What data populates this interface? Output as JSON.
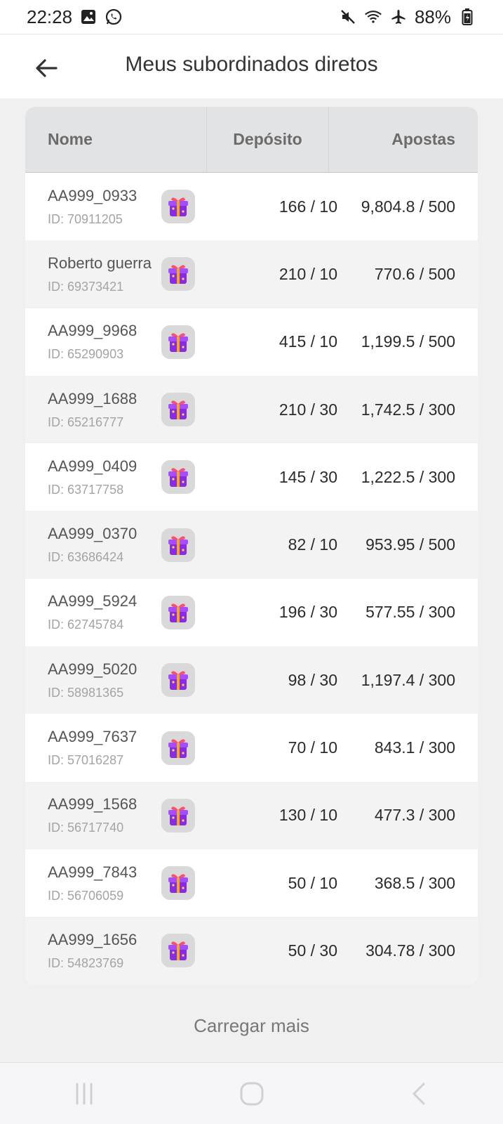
{
  "status_bar": {
    "time": "22:28",
    "battery": "88%",
    "icons": [
      "gallery-icon",
      "whatsapp-icon",
      "mute-icon",
      "wifi-icon",
      "airplane-icon",
      "battery-icon"
    ]
  },
  "header": {
    "title": "Meus subordinados diretos",
    "back_icon": "arrow-left-icon"
  },
  "table": {
    "columns": [
      "Nome",
      "Depósito",
      "Apostas"
    ],
    "rows": [
      {
        "name": "AA999_0933",
        "id": "ID: 70911205",
        "deposit": "166 / 10",
        "bets": "9,804.8 / 500"
      },
      {
        "name": "Roberto guerra",
        "id": "ID: 69373421",
        "deposit": "210 / 10",
        "bets": "770.6 / 500"
      },
      {
        "name": "AA999_9968",
        "id": "ID: 65290903",
        "deposit": "415 / 10",
        "bets": "1,199.5 / 500"
      },
      {
        "name": "AA999_1688",
        "id": "ID: 65216777",
        "deposit": "210 / 30",
        "bets": "1,742.5 / 300"
      },
      {
        "name": "AA999_0409",
        "id": "ID: 63717758",
        "deposit": "145 / 30",
        "bets": "1,222.5 / 300"
      },
      {
        "name": "AA999_0370",
        "id": "ID: 63686424",
        "deposit": "82 / 10",
        "bets": "953.95 / 500"
      },
      {
        "name": "AA999_5924",
        "id": "ID: 62745784",
        "deposit": "196 / 30",
        "bets": "577.55 / 300"
      },
      {
        "name": "AA999_5020",
        "id": "ID: 58981365",
        "deposit": "98 / 30",
        "bets": "1,197.4 / 300"
      },
      {
        "name": "AA999_7637",
        "id": "ID: 57016287",
        "deposit": "70 / 10",
        "bets": "843.1 / 300"
      },
      {
        "name": "AA999_1568",
        "id": "ID: 56717740",
        "deposit": "130 / 10",
        "bets": "477.3 / 300"
      },
      {
        "name": "AA999_7843",
        "id": "ID: 56706059",
        "deposit": "50 / 10",
        "bets": "368.5 / 300"
      },
      {
        "name": "AA999_1656",
        "id": "ID: 54823769",
        "deposit": "50 / 30",
        "bets": "304.78 / 300"
      }
    ]
  },
  "load_more": "Carregar mais",
  "nav": {
    "items": [
      "recent-apps-icon",
      "home-icon",
      "back-icon"
    ]
  },
  "colors": {
    "gift_bg": "#d9d9d9",
    "gift_box": "#8a2be2",
    "gift_ribbon": "#f5a623",
    "header_bg": "#e2e3e5"
  }
}
